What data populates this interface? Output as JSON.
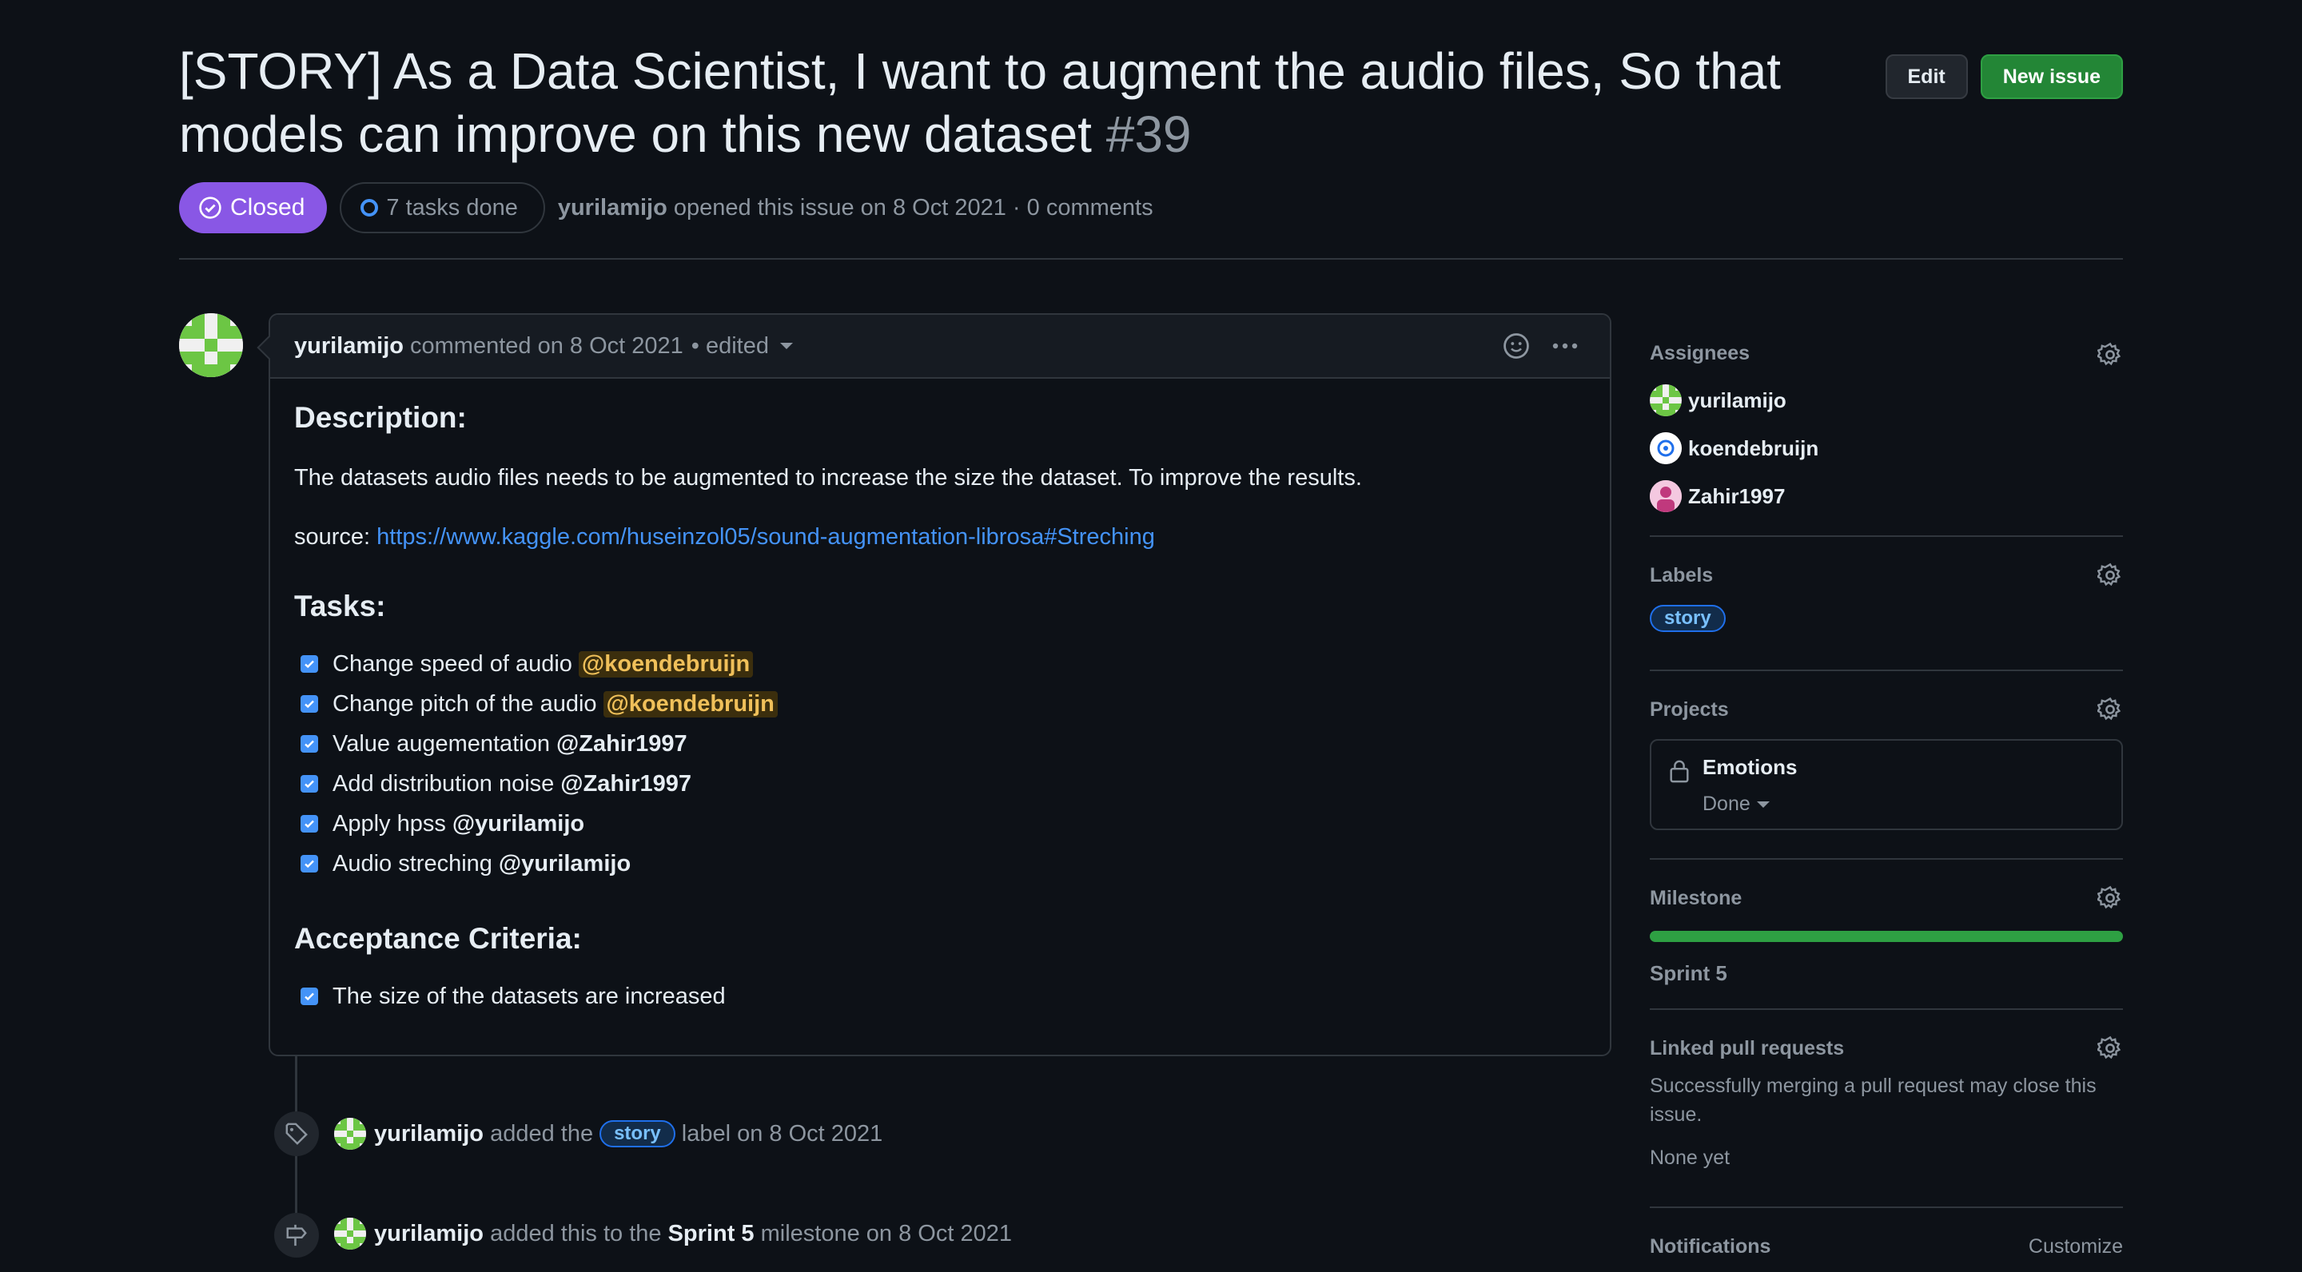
{
  "issue": {
    "title": "[STORY] As a Data Scientist, I want to augment the audio files, So that models can improve on this new dataset",
    "number": "#39",
    "edit_label": "Edit",
    "new_issue_label": "New issue",
    "state": "Closed",
    "tasks_done": "7 tasks done",
    "author": "yurilamijo",
    "opened_text": "opened this issue on 8 Oct 2021 · 0 comments"
  },
  "comment": {
    "author": "yurilamijo",
    "action": "commented on 8 Oct 2021",
    "edited": "• edited",
    "description_heading": "Description:",
    "description_text": "The datasets audio files needs to be augmented to increase the size the dataset. To improve the results.",
    "source_label": "source:",
    "source_url": "https://www.kaggle.com/huseinzol05/sound-augmentation-librosa#Streching",
    "tasks_heading": "Tasks:",
    "tasks": [
      {
        "text": "Change speed of audio",
        "mention": "@koendebruijn",
        "checked": true
      },
      {
        "text": "Change pitch of the audio",
        "mention": "@koendebruijn",
        "checked": true
      },
      {
        "text": "Value augementation",
        "mention": "@Zahir1997",
        "checked": true
      },
      {
        "text": "Add distribution noise",
        "mention": "@Zahir1997",
        "checked": true
      },
      {
        "text": "Apply hpss",
        "mention": "@yurilamijo",
        "checked": true
      },
      {
        "text": "Audio streching",
        "mention": "@yurilamijo",
        "checked": true
      }
    ],
    "acceptance_heading": "Acceptance Criteria:",
    "acceptance": [
      {
        "text": "The size of the datasets are increased",
        "checked": true
      }
    ]
  },
  "timeline": [
    {
      "actor": "yurilamijo",
      "pre": "added the",
      "label": "story",
      "post": "label on 8 Oct 2021"
    },
    {
      "actor": "yurilamijo",
      "pre": "added this to the",
      "milestone": "Sprint 5",
      "post": "milestone on 8 Oct 2021"
    }
  ],
  "sidebar": {
    "assignees_title": "Assignees",
    "assignees": [
      "yurilamijo",
      "koendebruijn",
      "Zahir1997"
    ],
    "labels_title": "Labels",
    "labels": [
      "story"
    ],
    "projects_title": "Projects",
    "project_name": "Emotions",
    "project_status": "Done",
    "milestone_title": "Milestone",
    "milestone_name": "Sprint 5",
    "milestone_progress": 1.0,
    "linked_title": "Linked pull requests",
    "linked_text": "Successfully merging a pull request may close this issue.",
    "linked_none": "None yet",
    "notifications_title": "Notifications",
    "notifications_action": "Customize"
  },
  "colors": {
    "closed": "#8957e5",
    "new_issue": "#238636",
    "link": "#4493f8",
    "mention_highlight": "#3b2e0d",
    "progress": "#2ea043"
  }
}
